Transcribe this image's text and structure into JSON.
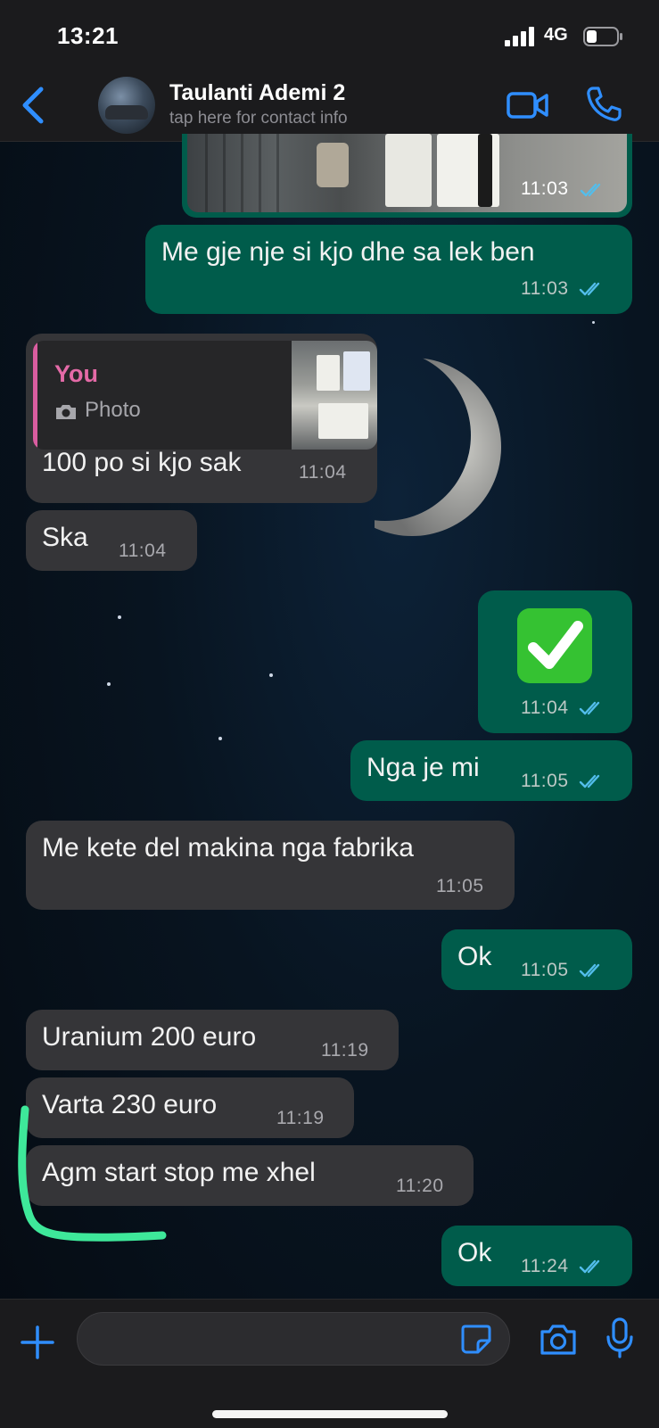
{
  "status_bar": {
    "time": "13:21",
    "network": "4G",
    "icons": [
      "signal-icon",
      "battery-icon"
    ]
  },
  "header": {
    "contact_name": "Taulanti Ademi 2",
    "subtitle": "tap here for contact info",
    "icons": [
      "chevron-left-icon",
      "video-camera-icon",
      "phone-icon"
    ],
    "accent_color": "#2f8eff"
  },
  "messages": [
    {
      "direction": "outgoing",
      "type": "photo",
      "time": "11:03"
    },
    {
      "direction": "outgoing",
      "text": "Me gje nje si kjo dhe sa lek ben",
      "time": "11:03"
    },
    {
      "direction": "incoming",
      "reply_to": {
        "author": "You",
        "label": "Photo"
      },
      "text": "100 po si kjo sak",
      "time": "11:04"
    },
    {
      "direction": "incoming",
      "text": "Ska",
      "time": "11:04"
    },
    {
      "direction": "outgoing",
      "type": "emoji",
      "emoji": "✅",
      "time": "11:04"
    },
    {
      "direction": "outgoing",
      "text": "Nga je mi",
      "time": "11:05"
    },
    {
      "direction": "incoming",
      "text": "Me kete del makina nga fabrika",
      "time": "11:05"
    },
    {
      "direction": "outgoing",
      "text": "Ok",
      "time": "11:05"
    },
    {
      "direction": "incoming",
      "text": "Uranium 200 euro",
      "time": "11:19"
    },
    {
      "direction": "incoming",
      "text": "Varta 230 euro",
      "time": "11:19"
    },
    {
      "direction": "incoming",
      "text": "Agm start stop me xhel",
      "time": "11:20"
    },
    {
      "direction": "outgoing",
      "text": "Ok",
      "time": "11:24"
    }
  ],
  "input_bar": {
    "placeholder": "",
    "icons": [
      "plus-icon",
      "sticker-icon",
      "camera-icon",
      "microphone-icon"
    ]
  },
  "colors": {
    "outgoing_bubble": "#005c4b",
    "incoming_bubble": "#353538",
    "read_ticks": "#53bdeb",
    "reply_accent": "#e46aa7",
    "annotation_highlight": "#3ee89a"
  }
}
